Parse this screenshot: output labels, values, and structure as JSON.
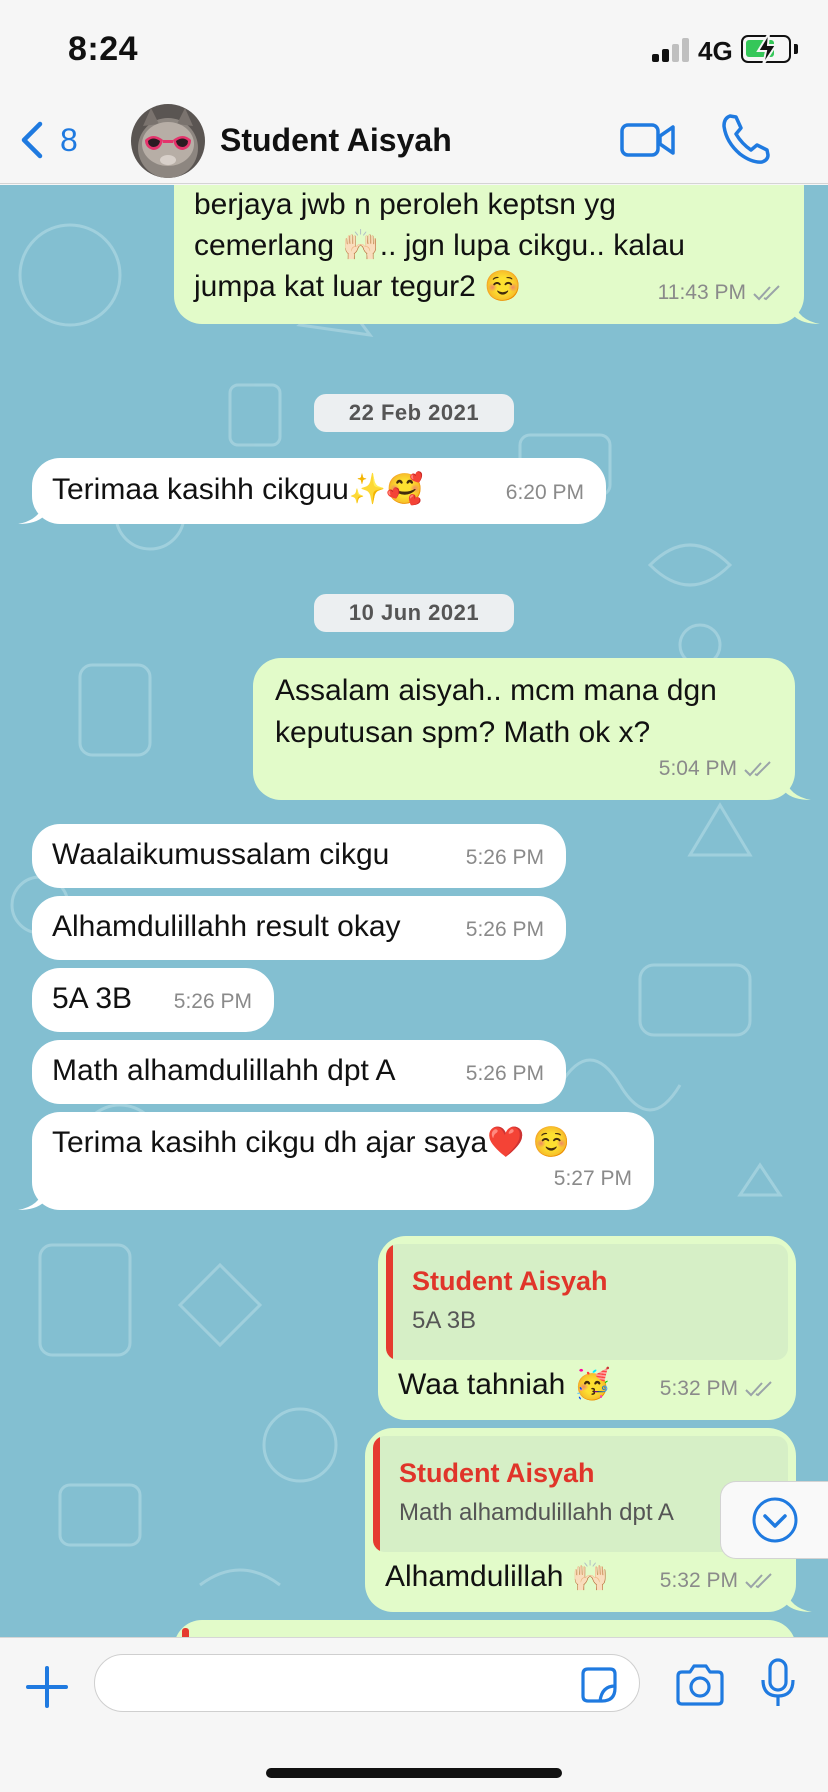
{
  "status_bar": {
    "time": "8:24",
    "network": "4G"
  },
  "header": {
    "back_count": "8",
    "contact_name": "Student Aisyah",
    "icons": [
      "chevron-left-icon",
      "video-call-icon",
      "phone-call-icon"
    ]
  },
  "colors": {
    "accent": "#1f7ae0",
    "outgoing_bubble": "#e2fbc9",
    "incoming_bubble": "#ffffff",
    "chat_background": "#83bfd1",
    "quote_name": "#e0352a"
  },
  "messages": {
    "m0": {
      "lines": [
        "berjaya jwb n peroleh keptsn yg",
        "cemerlang 🙌🏻.. jgn lupa cikgu.. kalau",
        "jumpa kat luar tegur2 ☺️"
      ],
      "time": "11:43 PM",
      "direction": "outgoing"
    },
    "date1": "22 Feb 2021",
    "m1": {
      "text": "Terimaa kasihh cikguu✨🥰",
      "time": "6:20 PM",
      "direction": "incoming"
    },
    "date2": "10 Jun 2021",
    "m2": {
      "lines": [
        "Assalam aisyah.. mcm mana dgn",
        "keputusan spm? Math ok x?"
      ],
      "time": "5:04 PM",
      "direction": "outgoing"
    },
    "m3": {
      "text": "Waalaikumussalam cikgu",
      "time": "5:26 PM",
      "direction": "incoming"
    },
    "m4": {
      "text": "Alhamdulillahh result okay",
      "time": "5:26 PM",
      "direction": "incoming"
    },
    "m5": {
      "text": "5A 3B",
      "time": "5:26 PM",
      "direction": "incoming"
    },
    "m6": {
      "text": "Math alhamdulillahh dpt A",
      "time": "5:26 PM",
      "direction": "incoming"
    },
    "m7": {
      "text": "Terima kasihh cikgu dh ajar saya❤️ ☺️",
      "time": "5:27 PM",
      "direction": "incoming"
    },
    "m8": {
      "quote_name": "Student Aisyah",
      "quote_text": "5A 3B",
      "text": "Waa tahniah 🥳",
      "time": "5:32 PM",
      "direction": "outgoing"
    },
    "m9": {
      "quote_name": "Student Aisyah",
      "quote_text": "Math alhamdulillahh dpt A",
      "text": "Alhamdulillah 🙌🏻",
      "time": "5:32 PM",
      "direction": "outgoing"
    }
  },
  "input_bar": {
    "placeholder": "",
    "icons": [
      "plus-icon",
      "sticker-icon",
      "camera-icon",
      "microphone-icon"
    ]
  }
}
